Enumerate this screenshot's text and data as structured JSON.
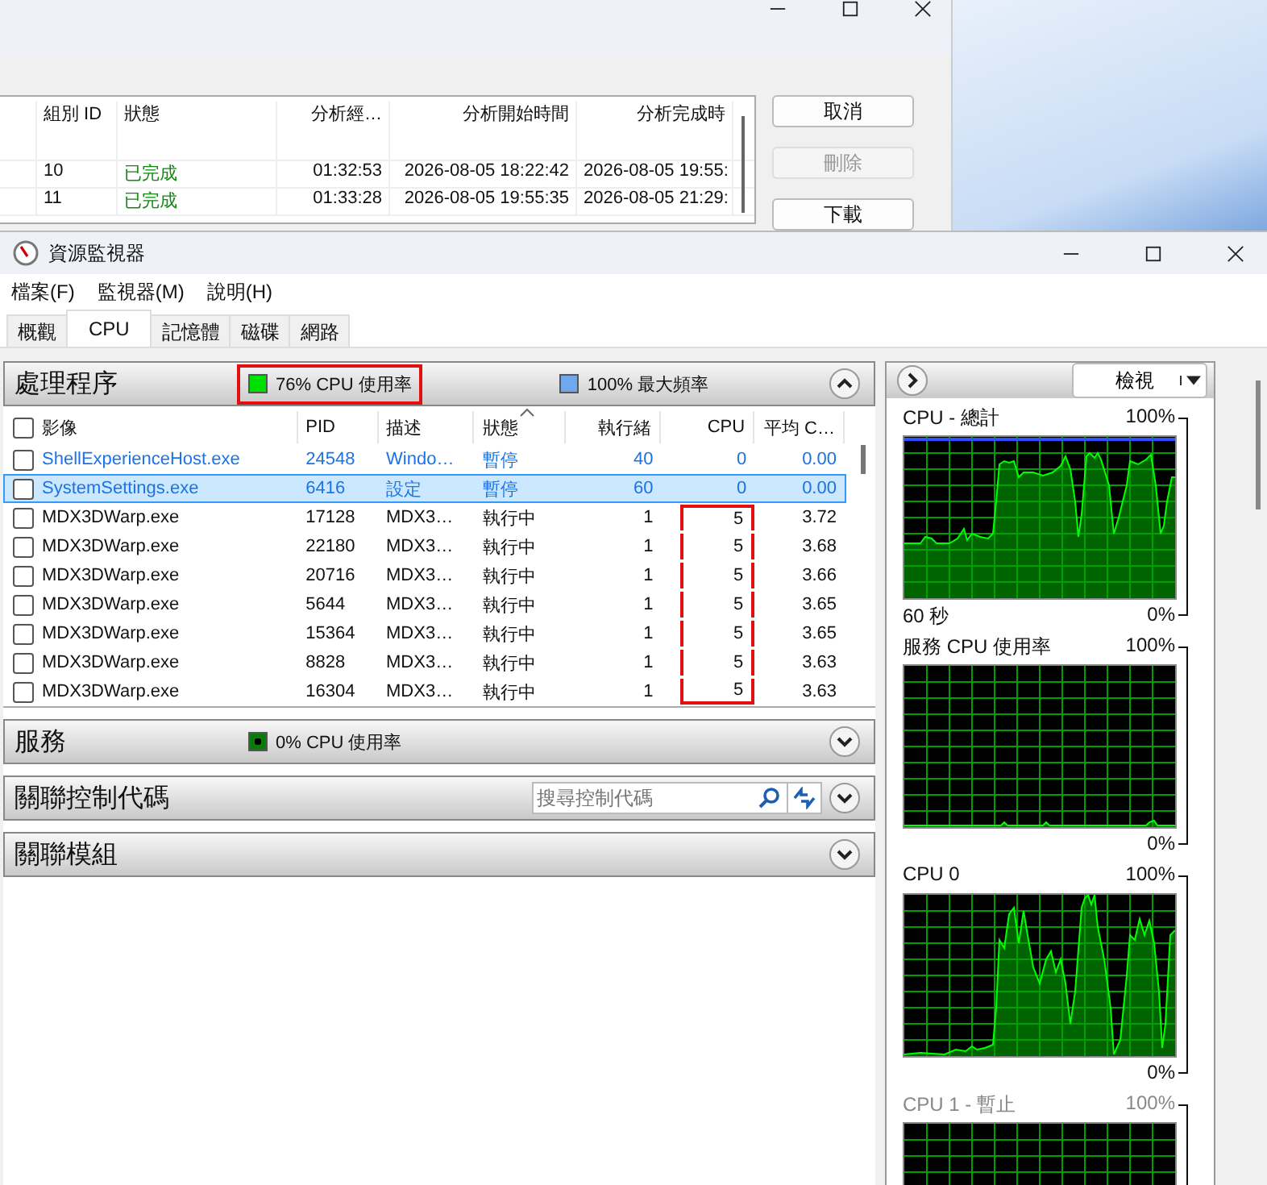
{
  "background_window": {
    "table": {
      "columns": [
        "組別 ID",
        "狀態",
        "分析經…",
        "分析開始時間",
        "分析完成時"
      ],
      "rows": [
        {
          "group_id": "10",
          "status": "已完成",
          "elapsed": "01:32:53",
          "start": "2026-08-05 18:22:42",
          "end": "2026-08-05 19:55:"
        },
        {
          "group_id": "11",
          "status": "已完成",
          "elapsed": "01:33:28",
          "start": "2026-08-05 19:55:35",
          "end": "2026-08-05 21:29:"
        }
      ]
    },
    "buttons": [
      {
        "label": "取消",
        "disabled": false
      },
      {
        "label": "刪除",
        "disabled": true
      },
      {
        "label": "下載",
        "disabled": false
      }
    ]
  },
  "window": {
    "title": "資源監視器"
  },
  "menu": [
    "檔案(F)",
    "監視器(M)",
    "說明(H)"
  ],
  "tabs": [
    {
      "label": "概觀",
      "selected": false
    },
    {
      "label": "CPU",
      "selected": true
    },
    {
      "label": "記憶體",
      "selected": false
    },
    {
      "label": "磁碟",
      "selected": false
    },
    {
      "label": "網路",
      "selected": false
    }
  ],
  "processes": {
    "title": "處理程序",
    "expanded": true,
    "indicators": [
      {
        "text": "76% CPU 使用率",
        "color": "#00e000",
        "highlighted": true
      },
      {
        "text": "100% 最大頻率",
        "color": "#6fa8ef",
        "highlighted": false
      }
    ],
    "columns": [
      {
        "label": "影像",
        "sorted": false
      },
      {
        "label": "PID",
        "sorted": false
      },
      {
        "label": "描述",
        "sorted": false
      },
      {
        "label": "狀態",
        "sorted": true
      },
      {
        "label": "執行緒",
        "sorted": false
      },
      {
        "label": "CPU",
        "sorted": false
      },
      {
        "label": "平均 C…",
        "sorted": false
      }
    ],
    "rows": [
      {
        "image": "ShellExperienceHost.exe",
        "pid": "24548",
        "description": "Windo…",
        "state": "暫停",
        "threads": "40",
        "cpu": "0",
        "avg_cpu": "0.00",
        "checked": false,
        "selected": false,
        "suspended": true,
        "cpu_marked": false
      },
      {
        "image": "SystemSettings.exe",
        "pid": "6416",
        "description": "設定",
        "state": "暫停",
        "threads": "60",
        "cpu": "0",
        "avg_cpu": "0.00",
        "checked": false,
        "selected": true,
        "suspended": true,
        "cpu_marked": false
      },
      {
        "image": "MDX3DWarp.exe",
        "pid": "17128",
        "description": "MDX3…",
        "state": "執行中",
        "threads": "1",
        "cpu": "5",
        "avg_cpu": "3.72",
        "checked": false,
        "selected": false,
        "suspended": false,
        "cpu_marked": true
      },
      {
        "image": "MDX3DWarp.exe",
        "pid": "22180",
        "description": "MDX3…",
        "state": "執行中",
        "threads": "1",
        "cpu": "5",
        "avg_cpu": "3.68",
        "checked": false,
        "selected": false,
        "suspended": false,
        "cpu_marked": true
      },
      {
        "image": "MDX3DWarp.exe",
        "pid": "20716",
        "description": "MDX3…",
        "state": "執行中",
        "threads": "1",
        "cpu": "5",
        "avg_cpu": "3.66",
        "checked": false,
        "selected": false,
        "suspended": false,
        "cpu_marked": true
      },
      {
        "image": "MDX3DWarp.exe",
        "pid": "5644",
        "description": "MDX3…",
        "state": "執行中",
        "threads": "1",
        "cpu": "5",
        "avg_cpu": "3.65",
        "checked": false,
        "selected": false,
        "suspended": false,
        "cpu_marked": true
      },
      {
        "image": "MDX3DWarp.exe",
        "pid": "15364",
        "description": "MDX3…",
        "state": "執行中",
        "threads": "1",
        "cpu": "5",
        "avg_cpu": "3.65",
        "checked": false,
        "selected": false,
        "suspended": false,
        "cpu_marked": true
      },
      {
        "image": "MDX3DWarp.exe",
        "pid": "8828",
        "description": "MDX3…",
        "state": "執行中",
        "threads": "1",
        "cpu": "5",
        "avg_cpu": "3.63",
        "checked": false,
        "selected": false,
        "suspended": false,
        "cpu_marked": true
      },
      {
        "image": "MDX3DWarp.exe",
        "pid": "16304",
        "description": "MDX3…",
        "state": "執行中",
        "threads": "1",
        "cpu": "5",
        "avg_cpu": "3.63",
        "checked": false,
        "selected": false,
        "suspended": false,
        "cpu_marked": true
      }
    ],
    "header_checked": false
  },
  "services": {
    "title": "服務",
    "expanded": false,
    "indicator": {
      "text": "0% CPU 使用率",
      "color": "#0a7a0a"
    }
  },
  "handles": {
    "title": "關聯控制代碼",
    "expanded": false,
    "search": {
      "placeholder": "搜尋控制代碼"
    }
  },
  "modules": {
    "title": "關聯模組",
    "expanded": false
  },
  "graph_panel": {
    "view_button": "檢視",
    "graphs": [
      {
        "title": "CPU - 總計",
        "max": "100%",
        "time": "60 秒",
        "min": "0%",
        "parked": false
      },
      {
        "title": "服務 CPU 使用率",
        "max": "100%",
        "min": "0%",
        "parked": false
      },
      {
        "title": "CPU 0",
        "max": "100%",
        "min": "0%",
        "parked": false
      },
      {
        "title": "CPU 1 - 暫止",
        "max": "100%",
        "parked": true
      }
    ]
  }
}
